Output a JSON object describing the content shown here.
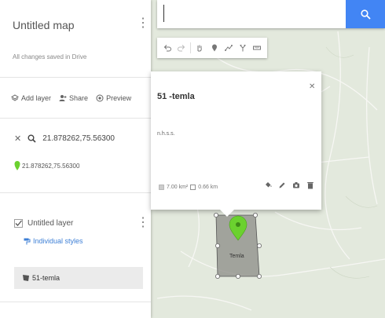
{
  "panel": {
    "map_title": "Untitled map",
    "saved_status": "All changes saved in Drive",
    "actions": {
      "add_layer": "Add layer",
      "share": "Share",
      "preview": "Preview"
    },
    "search_query": "21.878262,75.56300",
    "search_result": "21.878262,75.56300",
    "layer": {
      "name": "Untitled layer",
      "styles_link": "Individual styles",
      "feature": "51-temla"
    }
  },
  "search": {
    "value": "",
    "placeholder": ""
  },
  "popup": {
    "title": "51 -temla",
    "description": "n.h.s.s.",
    "area": "7.00 km²",
    "perimeter": "0.66 km"
  },
  "map": {
    "polygon_label": "Temla"
  },
  "colors": {
    "accent": "#4285f4",
    "pin": "#6bd12f",
    "link": "#3d7fd6",
    "polygon_fill": "#8b8b86"
  }
}
